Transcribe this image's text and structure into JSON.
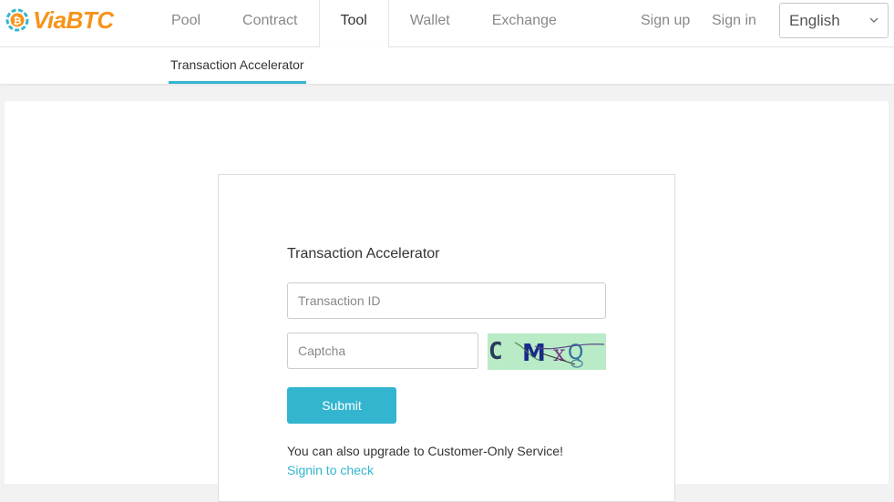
{
  "brand": {
    "name": "ViaBTC",
    "accent": "#f7931a",
    "logo_icon": "bitcoin-ring-icon"
  },
  "nav": {
    "items": [
      {
        "label": "Pool",
        "active": false
      },
      {
        "label": "Contract",
        "active": false
      },
      {
        "label": "Tool",
        "active": true
      },
      {
        "label": "Wallet",
        "active": false
      },
      {
        "label": "Exchange",
        "active": false
      }
    ]
  },
  "auth": {
    "signup": "Sign up",
    "signin": "Sign in"
  },
  "language": {
    "selected": "English",
    "icon": "chevron-down-icon"
  },
  "subnav": {
    "active": "Transaction Accelerator"
  },
  "form": {
    "title": "Transaction Accelerator",
    "txid_placeholder": "Transaction ID",
    "txid_value": "",
    "captcha_placeholder": "Captcha",
    "captcha_value": "",
    "submit_label": "Submit",
    "note": "You can also upgrade to Customer-Only Service!",
    "link": "Signin to check"
  },
  "colors": {
    "primary": "#33b5cf",
    "captcha_bg": "#b9ebc6"
  }
}
